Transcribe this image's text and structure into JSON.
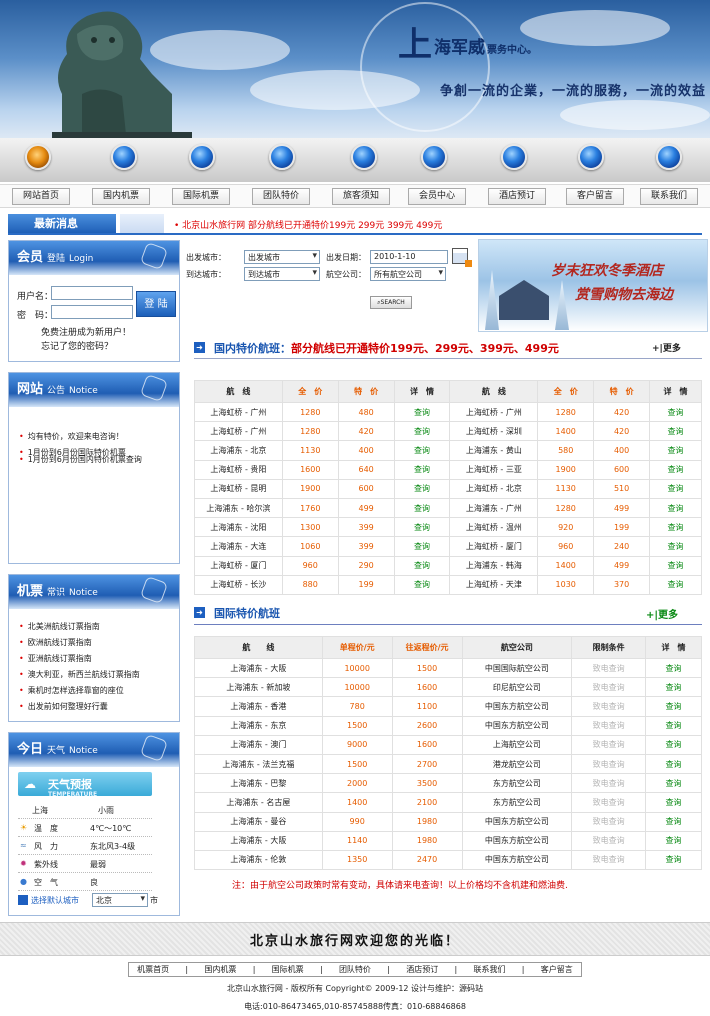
{
  "header": {
    "brand_big": "上",
    "brand_name": "海军威",
    "brand_suffix": "票务中心。",
    "slogan": "争創一流的企業，一流的服務，一流的效益"
  },
  "menu": [
    "网站首页",
    "国内机票",
    "国际机票",
    "团队特价",
    "旅客须知",
    "会员中心",
    "酒店预订",
    "客户留言",
    "联系我们"
  ],
  "news": {
    "tag": "最新消息",
    "text": "• 北京山水旅行网  部分航线已开通特价199元  299元  399元  499元"
  },
  "login": {
    "title": "会员",
    "title2": "登陆",
    "title_en": "Login",
    "user_label": "用户名：",
    "pwd_label": "密　码：",
    "button": "登 陆",
    "register": "免费注册成为新用户！",
    "forgot": "忘记了您的密码？"
  },
  "notice": {
    "title": "网站",
    "title2": "公告",
    "title_en": "Notice",
    "items": [
      "均有特价，欢迎来电咨询！",
      "1月份到6月份国际特价机票",
      "1月份到6月份国内特价机票查询"
    ]
  },
  "knowledge": {
    "title": "机票",
    "title2": "常识",
    "title_en": "Notice",
    "items": [
      "北美洲航线订票指南",
      "欧洲航线订票指南",
      "亚洲航线订票指南",
      "澳大利亚，新西兰航线订票指南",
      "乘机时怎样选择靠窗的座位",
      "出发前如何整理好行囊"
    ]
  },
  "weather": {
    "title": "今日",
    "title2": "天气",
    "title_en": "Notice",
    "panel_title": "天气预报",
    "panel_sub": "TEMPERATURE",
    "city": "上海",
    "condition": "小雨",
    "rows": [
      {
        "label": "温　度",
        "value": "4℃～10℃"
      },
      {
        "label": "风　力",
        "value": "东北风3-4级"
      },
      {
        "label": "紫外线",
        "value": "最弱"
      },
      {
        "label": "空　气",
        "value": "良"
      }
    ],
    "select_label": "选择默认城市",
    "select_value": "北京",
    "select_suffix": "市"
  },
  "search": {
    "from_label": "出发城市：",
    "from_value": "出发城市",
    "to_label": "到达城市：",
    "to_value": "到达城市",
    "date_label": "出发日期：",
    "date_value": "2010-1-10",
    "airline_label": "航空公司：",
    "airline_value": "所有航空公司",
    "button": "SEARCH"
  },
  "ad": {
    "line1": "岁末狂欢冬季酒店",
    "line2": "赏雪购物去海边"
  },
  "domestic": {
    "title": "国内特价航班：",
    "title_red": "部分航线已开通特价199元、299元、399元、499元",
    "more": "+|更多",
    "headers": [
      "航　线",
      "全　价",
      "特　价",
      "详　情",
      "航　线",
      "全　价",
      "特　价",
      "详　情"
    ],
    "rows": [
      [
        "上海虹桥 - 广州",
        "1280",
        "480",
        "查询",
        "上海虹桥 - 广州",
        "1280",
        "420",
        "查询"
      ],
      [
        "上海虹桥 - 广州",
        "1280",
        "420",
        "查询",
        "上海虹桥 - 深圳",
        "1400",
        "420",
        "查询"
      ],
      [
        "上海浦东 - 北京",
        "1130",
        "400",
        "查询",
        "上海浦东 - 黄山",
        "580",
        "400",
        "查询"
      ],
      [
        "上海虹桥 - 贵阳",
        "1600",
        "640",
        "查询",
        "上海虹桥 - 三亚",
        "1900",
        "600",
        "查询"
      ],
      [
        "上海虹桥 - 昆明",
        "1900",
        "600",
        "查询",
        "上海虹桥 - 北京",
        "1130",
        "510",
        "查询"
      ],
      [
        "上海浦东 - 哈尔滨",
        "1760",
        "499",
        "查询",
        "上海浦东 - 广州",
        "1280",
        "499",
        "查询"
      ],
      [
        "上海浦东 - 沈阳",
        "1300",
        "399",
        "查询",
        "上海虹桥 - 温州",
        "920",
        "199",
        "查询"
      ],
      [
        "上海浦东 - 大连",
        "1060",
        "399",
        "查询",
        "上海虹桥 - 厦门",
        "960",
        "240",
        "查询"
      ],
      [
        "上海虹桥 - 厦门",
        "960",
        "290",
        "查询",
        "上海浦东 - 韩海",
        "1400",
        "499",
        "查询"
      ],
      [
        "上海虹桥 - 长沙",
        "880",
        "199",
        "查询",
        "上海虹桥 - 天津",
        "1030",
        "370",
        "查询"
      ]
    ]
  },
  "international": {
    "title": "国际特价航班",
    "more": "+|更多",
    "headers": [
      "航　　线",
      "单程价/元",
      "往返程价/元",
      "航空公司",
      "限制条件",
      "详　情"
    ],
    "rows": [
      [
        "上海浦东 - 大阪",
        "10000",
        "1500",
        "中国国际航空公司",
        "致电查询",
        "查询"
      ],
      [
        "上海浦东 - 新加坡",
        "10000",
        "1600",
        "印尼航空公司",
        "致电查询",
        "查询"
      ],
      [
        "上海浦东 - 香港",
        "780",
        "1100",
        "中国东方航空公司",
        "致电查询",
        "查询"
      ],
      [
        "上海浦东 - 东京",
        "1500",
        "2600",
        "中国东方航空公司",
        "致电查询",
        "查询"
      ],
      [
        "上海浦东 - 澳门",
        "9000",
        "1600",
        "上海航空公司",
        "致电查询",
        "查询"
      ],
      [
        "上海浦东 - 法兰克福",
        "1500",
        "2700",
        "港龙航空公司",
        "致电查询",
        "查询"
      ],
      [
        "上海浦东 - 巴黎",
        "2000",
        "3500",
        "东方航空公司",
        "致电查询",
        "查询"
      ],
      [
        "上海浦东 - 名古屋",
        "1400",
        "2100",
        "东方航空公司",
        "致电查询",
        "查询"
      ],
      [
        "上海浦东 - 曼谷",
        "990",
        "1980",
        "中国东方航空公司",
        "致电查询",
        "查询"
      ],
      [
        "上海浦东 - 大阪",
        "1140",
        "1980",
        "中国东方航空公司",
        "致电查询",
        "查询"
      ],
      [
        "上海浦东 - 伦敦",
        "1350",
        "2470",
        "中国东方航空公司",
        "致电查询",
        "查询"
      ]
    ],
    "note": "注：由于航空公司政策时常有变动，具体请来电查询！以上价格均不含机建和燃油费."
  },
  "footer": {
    "title": "北京山水旅行网欢迎您的光临！",
    "nav": [
      "机票首页",
      "|",
      "国内机票",
      "|",
      "国际机票",
      "|",
      "团队特价",
      "|",
      "酒店预订",
      "|",
      "联系我们",
      "|",
      "客户留言"
    ],
    "copyright": "北京山水旅行网 - 版权所有  Copyright© 2009-12 设计与维护：源码站",
    "contact": "电话:010-86473465,010-85745888传真：010-68846868"
  },
  "colors": {
    "brand_blue": "#1d5fc0",
    "price_orange": "#e65c00",
    "link_green": "#0a8a14",
    "alert_red": "#d00000"
  }
}
